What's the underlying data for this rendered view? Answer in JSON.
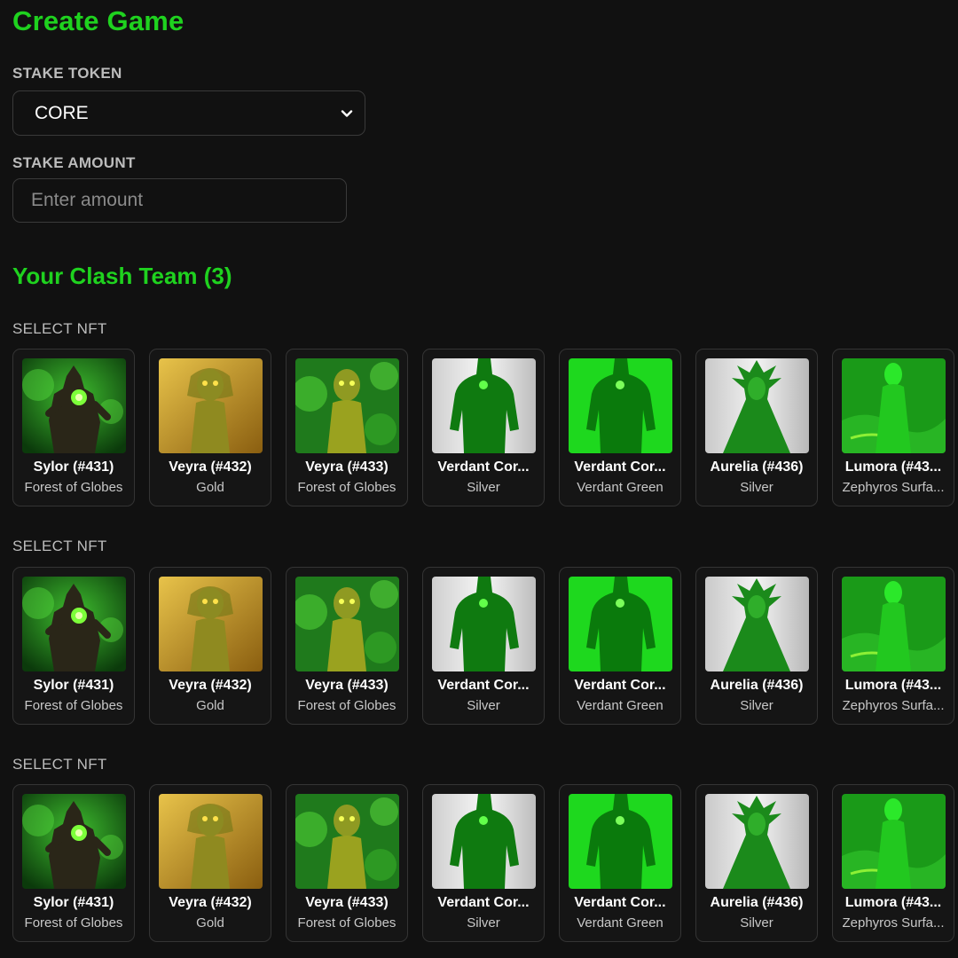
{
  "header": {
    "title": "Create Game"
  },
  "stake_token": {
    "label": "STAKE TOKEN",
    "selected": "CORE"
  },
  "stake_amount": {
    "label": "STAKE AMOUNT",
    "placeholder": "Enter amount",
    "value": ""
  },
  "team": {
    "title": "Your Clash Team (3)",
    "slots": [
      {
        "label": "SELECT NFT"
      },
      {
        "label": "SELECT NFT"
      },
      {
        "label": "SELECT NFT"
      }
    ]
  },
  "nfts": [
    {
      "name": "Sylor (#431)",
      "trait": "Forest of Globes",
      "art": "treant"
    },
    {
      "name": "Veyra (#432)",
      "trait": "Gold",
      "art": "dryad-gold"
    },
    {
      "name": "Veyra (#433)",
      "trait": "Forest of Globes",
      "art": "dryad-globes"
    },
    {
      "name": "Verdant Cor...",
      "trait": "Silver",
      "art": "silhouette-silver"
    },
    {
      "name": "Verdant Cor...",
      "trait": "Verdant Green",
      "art": "silhouette-green"
    },
    {
      "name": "Aurelia (#436)",
      "trait": "Silver",
      "art": "fairy-silver"
    },
    {
      "name": "Lumora (#43...",
      "trait": "Zephyros Surfa...",
      "art": "figure-zephyros"
    }
  ],
  "colors": {
    "accent": "#1fd21f",
    "background": "#111111",
    "card_border": "#343434"
  }
}
